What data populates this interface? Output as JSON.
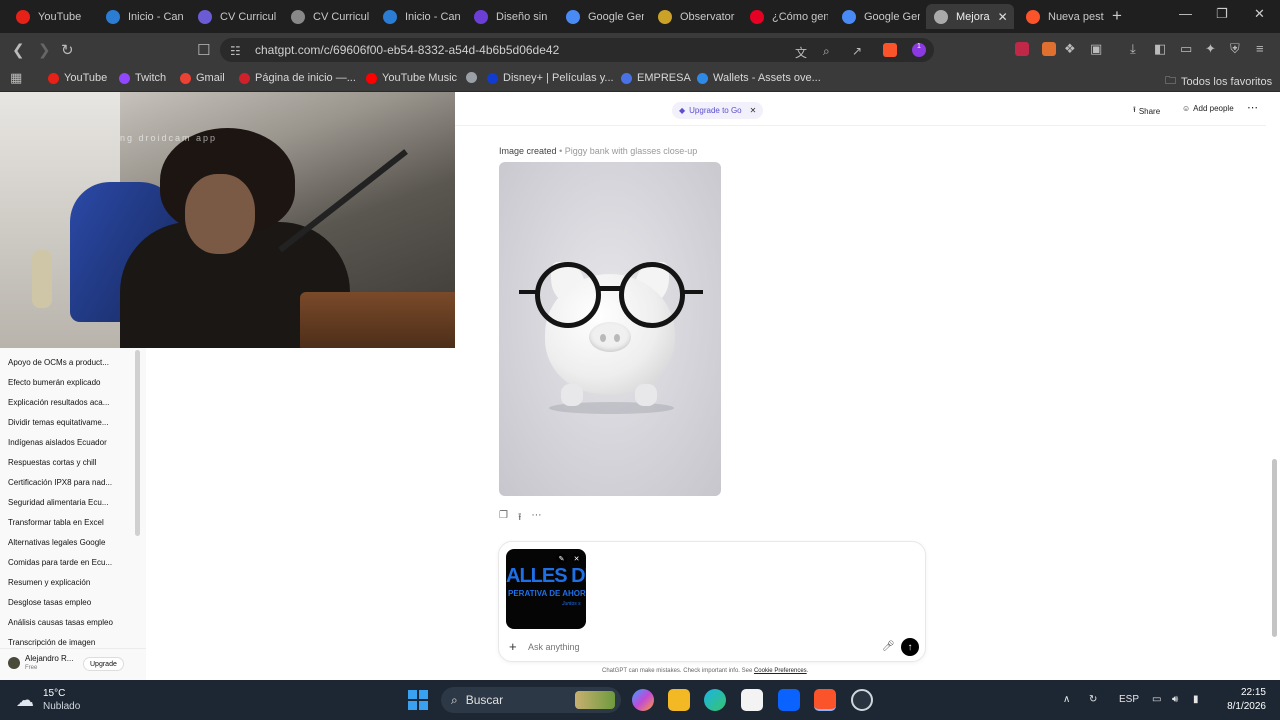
{
  "browser": {
    "tabs": [
      {
        "label": "YouTube",
        "color": "#e62117",
        "icon": "youtube-icon"
      },
      {
        "label": "Inicio - Can",
        "color": "#2b7cd3",
        "icon": "canva-icon"
      },
      {
        "label": "CV Curricul",
        "color": "#6b5cd6",
        "icon": "doc-icon"
      },
      {
        "label": "CV Curricul",
        "color": "#888888",
        "icon": "globe-icon"
      },
      {
        "label": "Inicio - Can",
        "color": "#2b7cd3",
        "icon": "canva-icon"
      },
      {
        "label": "Diseño sin",
        "color": "#6b3fd6",
        "icon": "shield-icon"
      },
      {
        "label": "Google Gen",
        "color": "#4a8af4",
        "icon": "gemini-icon"
      },
      {
        "label": "Observator",
        "color": "#c9a227",
        "icon": "seal-icon"
      },
      {
        "label": "¿Cómo gen",
        "color": "#e60023",
        "icon": "pinterest-icon"
      },
      {
        "label": "Google Gen",
        "color": "#4a8af4",
        "icon": "gemini-icon"
      },
      {
        "label": "Mejora",
        "color": "#aaaaaa",
        "icon": "chatgpt-icon",
        "active": true
      },
      {
        "label": "Nueva pest",
        "color": "#fb542b",
        "icon": "brave-icon"
      }
    ],
    "url": "chatgpt.com/c/69606f00-eb54-8332-a54d-4b6b5d06de42",
    "extension_badge": "1",
    "bookmarks": [
      {
        "label": "YouTube",
        "color": "#e62117"
      },
      {
        "label": "Twitch",
        "color": "#9146ff"
      },
      {
        "label": "Gmail",
        "color": "#ea4335"
      },
      {
        "label": "Página de inicio —...",
        "color": "#d0202a"
      },
      {
        "label": "YouTube Music",
        "color": "#ff0000"
      },
      {
        "label": "",
        "color": "#9aa0a6"
      },
      {
        "label": "Disney+ | Películas y...",
        "color": "#113ccf"
      },
      {
        "label": "EMPRESA",
        "color": "#4a72e8"
      },
      {
        "label": "Wallets - Assets ove...",
        "color": "#2e8ae6"
      }
    ],
    "all_bookmarks": "Todos los favoritos"
  },
  "webcam": {
    "overlay_text": "ng droidcam app"
  },
  "sidebar": {
    "items": [
      "Apoyo de OCMs a product...",
      "Efecto bumerán explicado",
      "Explicación resultados aca...",
      "Dividir temas equitativame...",
      "Indígenas aislados Ecuador",
      "Respuestas cortas y chill",
      "Certificación IPX8 para nad...",
      "Seguridad alimentaria Ecu...",
      "Transformar tabla en Excel",
      "Alternativas legales Google",
      "Comidas para tarde en Ecu...",
      "Resumen y explicación",
      "Desglose tasas empleo",
      "Análisis causas tasas empleo",
      "Transcripción de imagen"
    ],
    "user_name": "Alejandro R...",
    "user_plan": "Free",
    "upgrade_label": "Upgrade"
  },
  "chat": {
    "upgrade_pill": "Upgrade to Go",
    "share_label": "Share",
    "add_people_label": "Add people",
    "image_caption": "Image created",
    "image_subtitle": "• Piggy bank with glasses close-up",
    "attachment_text_big": "ALLES DI",
    "attachment_text_small": "PERATIVA DE AHOR",
    "attachment_text_tiny": "Juntos s",
    "placeholder": "Ask anything",
    "disclaimer": "ChatGPT can make mistakes. Check important info. See ",
    "disclaimer_link": "Cookie Preferences",
    "disclaimer_end": "."
  },
  "taskbar": {
    "temperature": "15°C",
    "weather": "Nublado",
    "search_label": "Buscar",
    "language": "ESP",
    "time": "22:15",
    "date": "8/1/2026"
  }
}
